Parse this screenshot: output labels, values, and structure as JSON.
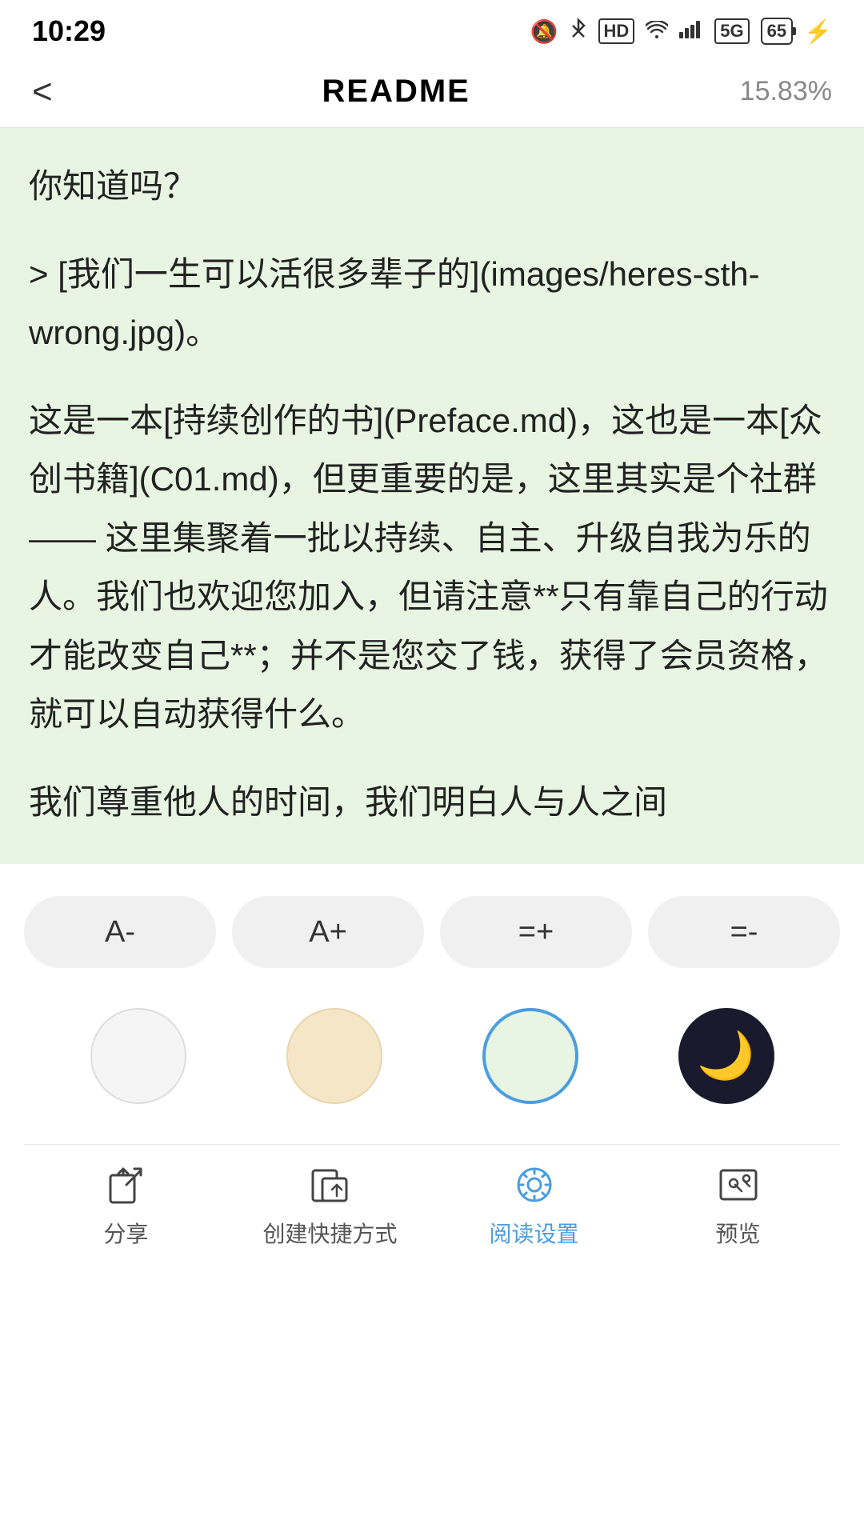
{
  "statusBar": {
    "time": "10:29",
    "batteryLevel": "65",
    "icons": [
      "mute",
      "bluetooth",
      "hd",
      "wifi",
      "signal",
      "battery",
      "charging"
    ]
  },
  "header": {
    "backLabel": "<",
    "title": "README",
    "progress": "15.83%"
  },
  "content": {
    "paragraphs": [
      "你知道吗？",
      "> [我们一生可以活很多辈子的](images/heres-sth-wrong.jpg)。",
      "这是一本[持续创作的书](Preface.md)，这也是一本[众创书籍](C01.md)，但更重要的是，这里其实是个社群 —— 这里集聚着一批以持续、自主、升级自我为乐的人。我们也欢迎您加入，但请注意**只有靠自己的行动才能改变自己**；并不是您交了钱，获得了会员资格，就可以自动获得什么。",
      "我们尊重他人的时间，我们明白人与人之间"
    ]
  },
  "fontControls": {
    "decreaseLabel": "A-",
    "increaseLabel": "A+",
    "lineIncreaseLabel": "=+",
    "lineDecreaseLabel": "=-"
  },
  "themes": [
    {
      "id": "white",
      "label": "白色主题"
    },
    {
      "id": "beige",
      "label": "米色主题"
    },
    {
      "id": "green",
      "label": "绿色主题",
      "active": true
    },
    {
      "id": "dark",
      "label": "深色主题"
    }
  ],
  "bottomNav": [
    {
      "id": "share",
      "label": "分享",
      "active": false
    },
    {
      "id": "shortcut",
      "label": "创建快捷方式",
      "active": false
    },
    {
      "id": "settings",
      "label": "阅读设置",
      "active": true
    },
    {
      "id": "preview",
      "label": "预览",
      "active": false
    }
  ]
}
